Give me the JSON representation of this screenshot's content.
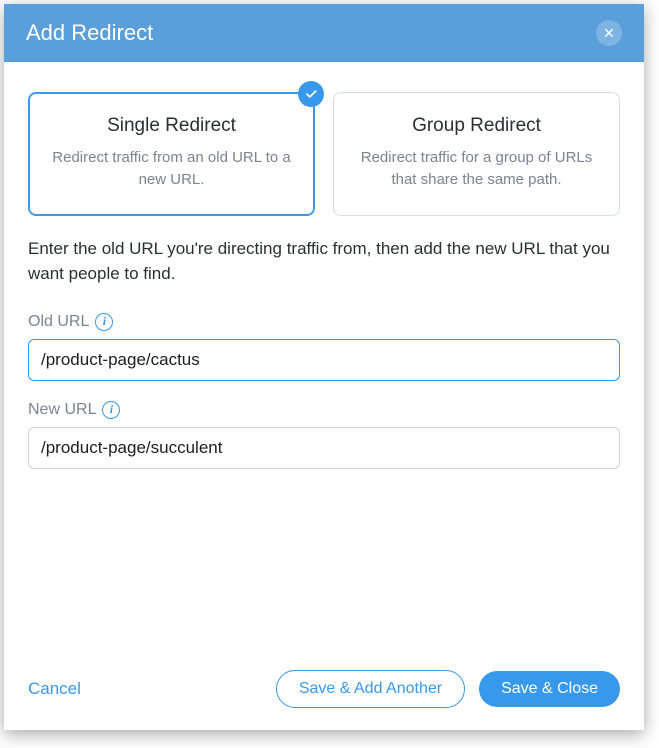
{
  "header": {
    "title": "Add Redirect"
  },
  "options": {
    "single": {
      "title": "Single Redirect",
      "desc": "Redirect traffic from an old URL to a new URL."
    },
    "group": {
      "title": "Group Redirect",
      "desc": "Redirect traffic for a group of URLs that share the same path."
    }
  },
  "instruction": "Enter the old URL you're directing traffic from, then add the new URL that you want people to find.",
  "fields": {
    "old_url": {
      "label": "Old URL",
      "value": "/product-page/cactus"
    },
    "new_url": {
      "label": "New URL",
      "value": "/product-page/succulent"
    }
  },
  "footer": {
    "cancel": "Cancel",
    "save_add_another": "Save & Add Another",
    "save_close": "Save & Close"
  }
}
